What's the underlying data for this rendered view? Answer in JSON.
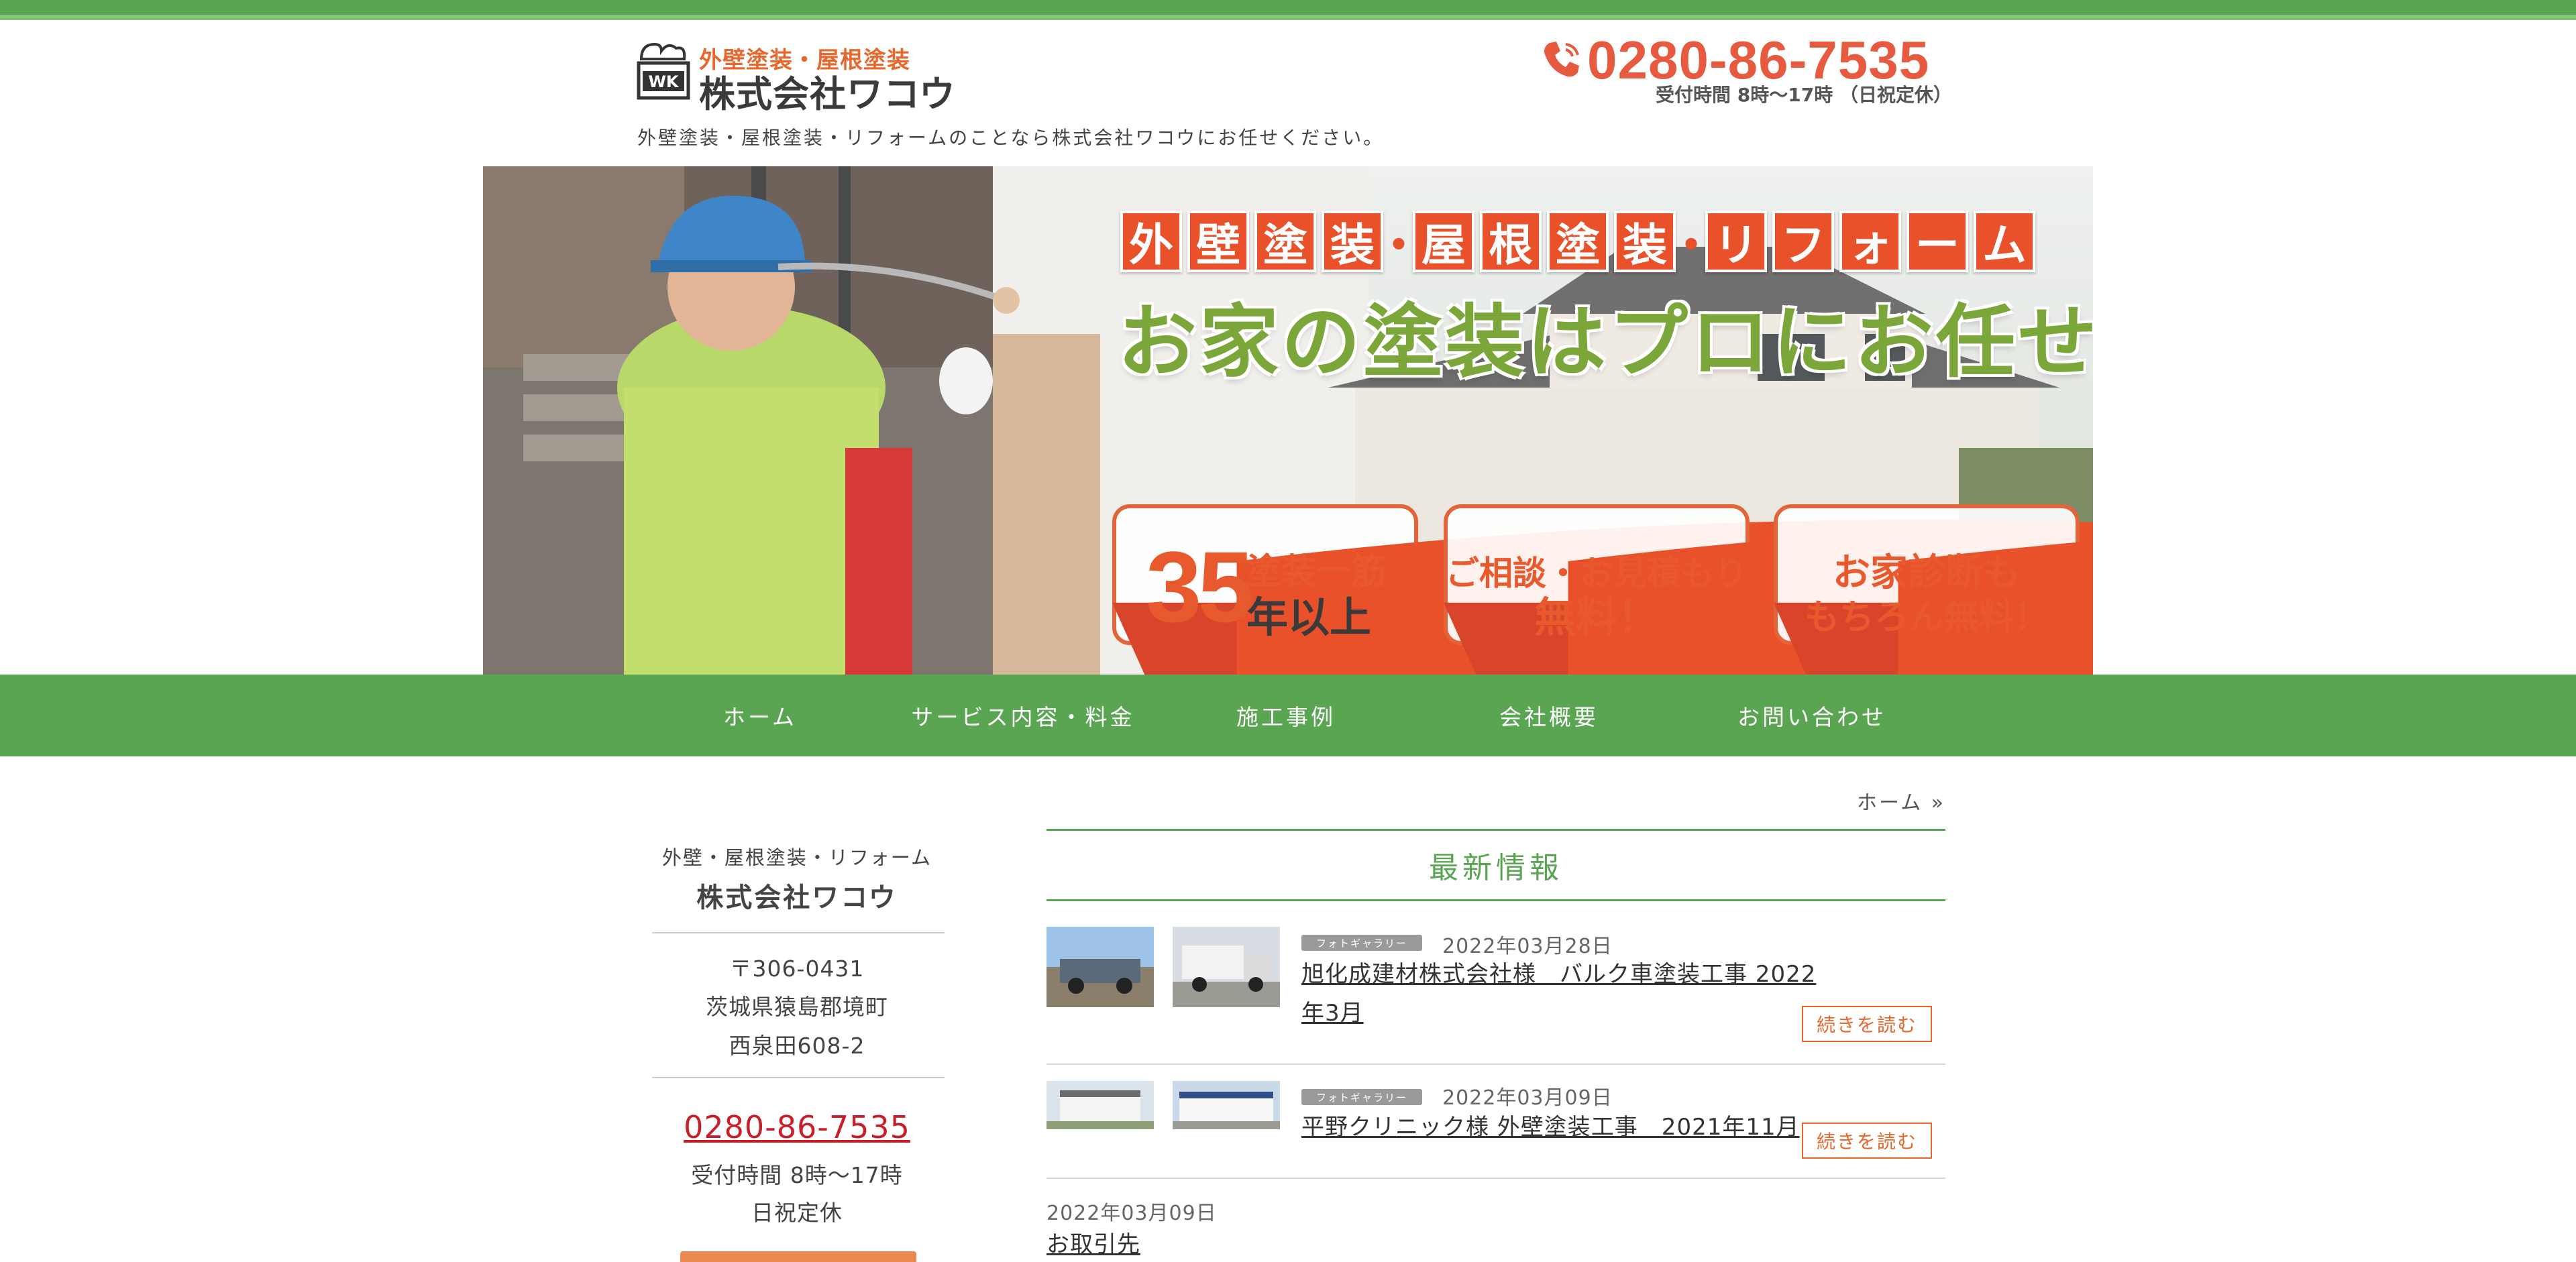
{
  "header": {
    "logo_sub": "外壁塗装・屋根塗装",
    "logo_main": "株式会社ワコウ",
    "logo_mark_text": "WK",
    "tagline": "外壁塗装・屋根塗装・リフォームのことなら株式会社ワコウにお任せください。",
    "phone": "0280-86-7535",
    "hours": "受付時間 8時〜17時 （日祝定休）"
  },
  "hero": {
    "title_chars_1": [
      "外",
      "壁",
      "塗",
      "装"
    ],
    "title_chars_2": [
      "屋",
      "根",
      "塗",
      "装"
    ],
    "title_chars_3": [
      "リ",
      "フ",
      "ォ",
      "ー",
      "ム"
    ],
    "separator": "・",
    "headline": "お家の塗装はプロにお任せ！",
    "badge1_num": "35",
    "badge1_line1": "塗装一筋",
    "badge1_line2": "年以上",
    "badge2_line1": "ご相談・お見積もり",
    "badge2_line2": "無料！",
    "badge3_line1": "お家診断も",
    "badge3_line2": "もちろん無料！"
  },
  "nav": {
    "items": [
      "ホーム",
      "サービス内容・料金",
      "施工事例",
      "会社概要",
      "お問い合わせ"
    ]
  },
  "sidebar": {
    "subtitle": "外壁・屋根塗装・リフォーム",
    "name": "株式会社ワコウ",
    "postal": "〒306-0431",
    "address1": "茨城県猿島郡境町",
    "address2": "西泉田608-2",
    "phone": "0280-86-7535",
    "hours": "受付時間 8時〜17時",
    "holiday": "日祝定休"
  },
  "main": {
    "breadcrumb": "ホーム »",
    "section_title": "最新情報",
    "posts": [
      {
        "category": "フォトギャラリー",
        "date": "2022年03月28日",
        "title": "旭化成建材株式会社様　バルク車塗装工事 2022年3月",
        "more": "続きを読む"
      },
      {
        "category": "フォトギャラリー",
        "date": "2022年03月09日",
        "title": "平野クリニック様 外壁塗装工事　2021年11月",
        "more": "続きを読む"
      }
    ],
    "plain_post": {
      "date": "2022年03月09日",
      "title": "お取引先"
    }
  },
  "colors": {
    "brand_green": "#5aa552",
    "accent_orange": "#e8672d",
    "phone_red": "#e85a3f",
    "sidebar_tel_red": "#c8202a"
  },
  "icons": {
    "logo": "paint-can-icon",
    "phone": "phone-icon",
    "breadcrumb_arrow": "double-chevron-right-icon"
  }
}
